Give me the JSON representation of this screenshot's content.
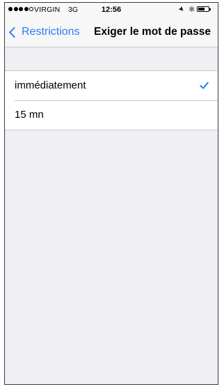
{
  "status_bar": {
    "carrier": "VIRGIN",
    "network": "3G",
    "time": "12:56",
    "signal_strength": 4,
    "icons": [
      "location-icon",
      "bluetooth-icon",
      "battery-icon"
    ]
  },
  "navbar": {
    "back_label": "Restrictions",
    "title": "Exiger le mot de passe"
  },
  "options": {
    "items": [
      {
        "label": "immédiatement",
        "selected": true
      },
      {
        "label": "15 mn",
        "selected": false
      }
    ]
  },
  "colors": {
    "accent": "#2a7ef5",
    "background": "#efeff4",
    "cell": "#ffffff",
    "separator": "#c8c7cc"
  }
}
